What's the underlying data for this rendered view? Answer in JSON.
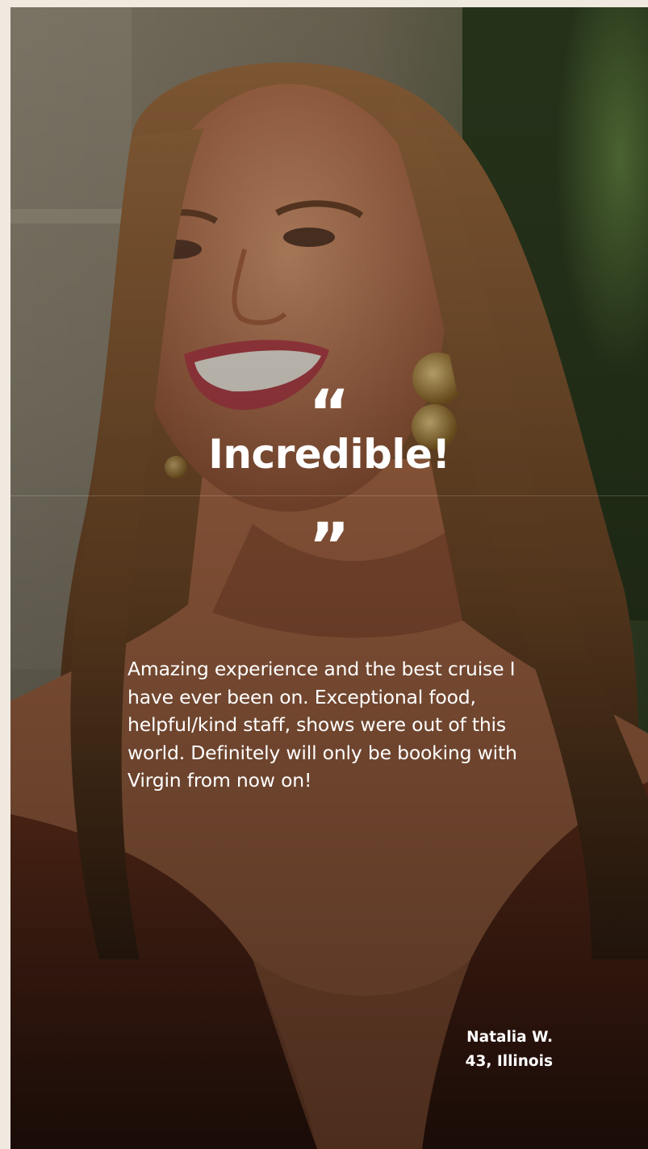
{
  "testimonial": {
    "open_quote": "“",
    "headline": "Incredible!",
    "close_quote": "”",
    "review_text": "Amazing experience and the best cruise I have ever been on. Exceptional food, helpful/kind staff, shows were out of this world. Definitely will only be booking with Virgin from now on!",
    "author_name": "Natalia W.",
    "author_details": "43, Illinois"
  },
  "colors": {
    "text": "#ffffff",
    "page_background": "#efe9df",
    "dress": "#7a3a22",
    "hair": "#8a5a30",
    "foliage": "#3f5a2c"
  },
  "icons": {
    "open_quote": "open-quote-icon",
    "close_quote": "close-quote-icon"
  }
}
